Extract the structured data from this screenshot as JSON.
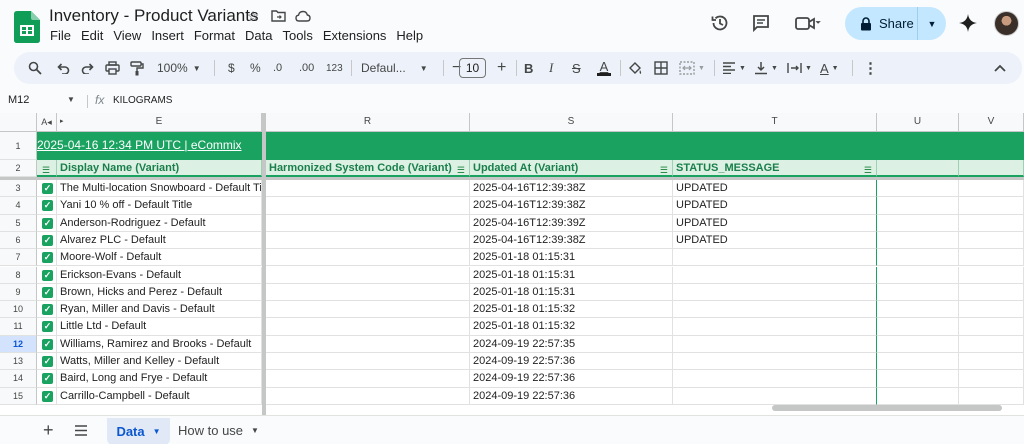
{
  "app": {
    "title": "Inventory - Product Variants",
    "menu": [
      "File",
      "Edit",
      "View",
      "Insert",
      "Format",
      "Data",
      "Tools",
      "Extensions",
      "Help"
    ],
    "share_label": "Share",
    "icons": {
      "title": [
        "star-icon",
        "folder-move-icon",
        "cloud-status-icon"
      ],
      "header": [
        "history-icon",
        "comments-icon",
        "meet-icon",
        "gemini-icon"
      ]
    },
    "brand_color": "#0f9d58"
  },
  "toolbar": {
    "zoom": "100%",
    "currency": "$",
    "percent": "%",
    "dec_decrease": ".0",
    "dec_increase": ".00",
    "number_format": "123",
    "font": "Defaul...",
    "font_size": "10",
    "bold": "B",
    "italic": "I",
    "strike": "S",
    "text_color": "A",
    "fill_text": "A"
  },
  "formula_bar": {
    "cell_ref": "M12",
    "fx": "fx",
    "value": "KILOGRAMS"
  },
  "columns": {
    "left": [
      "A",
      "E"
    ],
    "right": [
      "R",
      "S",
      "T",
      "U",
      "V"
    ]
  },
  "rows": [
    "1",
    "2",
    "3",
    "4",
    "5",
    "6",
    "7",
    "8",
    "9",
    "10",
    "11",
    "12",
    "13",
    "14",
    "15"
  ],
  "selected_row": "12",
  "banner": "2025-04-16 12:34 PM UTC | eCommix",
  "headers": {
    "display_name": "Display Name (Variant)",
    "harmonized": "Harmonized System Code (Variant)",
    "updated_at": "Updated At (Variant)",
    "status": "STATUS_MESSAGE"
  },
  "data_rows": [
    {
      "name": "The Multi-location Snowboard - Default Title",
      "updated": "2025-04-16T12:39:38Z",
      "status": "UPDATED"
    },
    {
      "name": "Yani 10 % off - Default Title",
      "updated": "2025-04-16T12:39:38Z",
      "status": "UPDATED"
    },
    {
      "name": "Anderson-Rodriguez - Default",
      "updated": "2025-04-16T12:39:39Z",
      "status": "UPDATED"
    },
    {
      "name": "Alvarez PLC - Default",
      "updated": "2025-04-16T12:39:38Z",
      "status": "UPDATED"
    },
    {
      "name": "Moore-Wolf - Default",
      "updated": "2025-01-18 01:15:31",
      "status": ""
    },
    {
      "name": "Erickson-Evans - Default",
      "updated": "2025-01-18 01:15:31",
      "status": ""
    },
    {
      "name": "Brown, Hicks and Perez - Default",
      "updated": "2025-01-18 01:15:31",
      "status": ""
    },
    {
      "name": "Ryan, Miller and Davis - Default",
      "updated": "2025-01-18 01:15:32",
      "status": ""
    },
    {
      "name": "Little Ltd - Default",
      "updated": "2025-01-18 01:15:32",
      "status": ""
    },
    {
      "name": "Williams, Ramirez and Brooks - Default",
      "updated": "2024-09-19 22:57:35",
      "status": ""
    },
    {
      "name": "Watts, Miller and Kelley - Default",
      "updated": "2024-09-19 22:57:36",
      "status": ""
    },
    {
      "name": "Baird, Long and Frye - Default",
      "updated": "2024-09-19 22:57:36",
      "status": ""
    },
    {
      "name": "Carrillo-Campbell - Default",
      "updated": "2024-09-19 22:57:36",
      "status": ""
    }
  ],
  "sheets": {
    "active": "Data",
    "other": "How to use"
  }
}
